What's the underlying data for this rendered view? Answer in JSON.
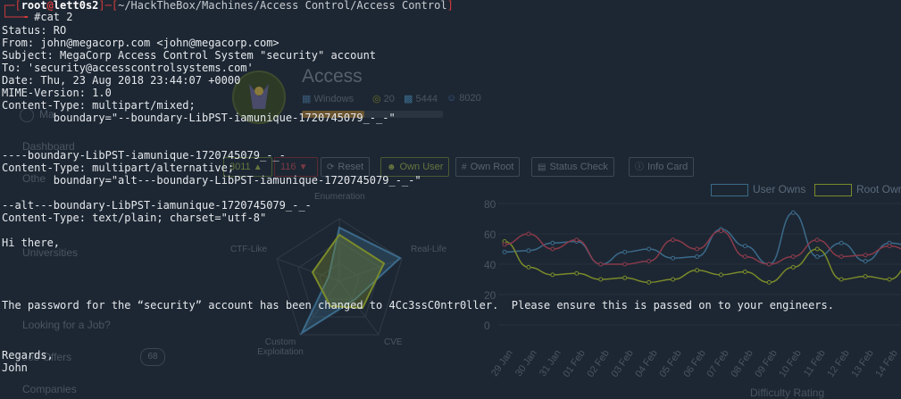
{
  "background": {
    "machine": {
      "name": "Access",
      "os": "Windows",
      "points": "20",
      "owns": "5444",
      "users": "8020",
      "nav_label": "Ma",
      "upvotes": "3011",
      "downvotes": "116"
    },
    "sidebar": [
      "Dashboard",
      "Othe",
      "Universities",
      "Looking for a Job?",
      "Job Offers",
      "Companies"
    ],
    "sidebar_badge": "68",
    "buttons": [
      {
        "icon": "refresh-icon",
        "label": "Reset"
      },
      {
        "icon": "user-icon",
        "label": "Own User"
      },
      {
        "icon": "hash-icon",
        "label": "Own Root"
      },
      {
        "icon": "check-icon",
        "label": "Status Check"
      },
      {
        "icon": "info-icon",
        "label": "Info Card"
      }
    ],
    "radar": {
      "labels": [
        "Enumeration",
        "Real-Life",
        "CVE",
        "Custom Exploitation",
        "CTF-Like"
      ]
    },
    "bottom_label": "Difficulty Rating",
    "chart_data": {
      "type": "line",
      "categories": [
        "29 Jan",
        "30 Jan",
        "31 Jan",
        "01 Feb",
        "02 Feb",
        "03 Feb",
        "04 Feb",
        "05 Feb",
        "06 Feb",
        "07 Feb",
        "08 Feb",
        "09 Feb",
        "10 Feb",
        "11 Feb",
        "12 Feb",
        "13 Feb",
        "14 Feb",
        "15"
      ],
      "series": [
        {
          "name": "User Owns",
          "color": "#3b6a8a",
          "values": [
            48,
            49,
            54,
            55,
            40,
            48,
            50,
            44,
            45,
            63,
            52,
            40,
            74,
            45,
            54,
            42,
            54,
            52
          ]
        },
        {
          "name": "Root Owns",
          "color": "#7a8a2a",
          "values": [
            55,
            38,
            33,
            34,
            30,
            31,
            28,
            30,
            36,
            33,
            35,
            28,
            38,
            50,
            30,
            32,
            30,
            42
          ]
        },
        {
          "name": "",
          "color": "#8a3a4a",
          "values": [
            53,
            60,
            50,
            56,
            40,
            40,
            42,
            56,
            50,
            62,
            45,
            40,
            45,
            56,
            45,
            46,
            52,
            48
          ]
        }
      ],
      "ylim": [
        0,
        80
      ],
      "yticks": [
        "80",
        "60",
        "40",
        "20",
        "0"
      ]
    }
  },
  "terminal": {
    "prompt_user": "root",
    "prompt_at": "@",
    "prompt_host": "lett0s2",
    "prompt_path": "~/HackTheBox/Machines/Access Control/Access Control",
    "command": "#cat 2",
    "lines": [
      "Status: RO",
      "From: john@megacorp.com <john@megacorp.com>",
      "Subject: MegaCorp Access Control System \"security\" account",
      "To: 'security@accesscontrolsystems.com'",
      "Date: Thu, 23 Aug 2018 23:44:07 +0000",
      "MIME-Version: 1.0",
      "Content-Type: multipart/mixed;",
      "        boundary=\"--boundary-LibPST-iamunique-1720745079_-_-\"",
      "",
      "",
      "----boundary-LibPST-iamunique-1720745079_-_-",
      "Content-Type: multipart/alternative;",
      "        boundary=\"alt---boundary-LibPST-iamunique-1720745079_-_-\"",
      "",
      "--alt---boundary-LibPST-iamunique-1720745079_-_-",
      "Content-Type: text/plain; charset=\"utf-8\"",
      "",
      "Hi there,",
      "",
      "",
      "",
      "",
      "The password for the “security” account has been changed to 4Cc3ssC0ntr0ller.  Please ensure this is passed on to your engineers.",
      "",
      "",
      "",
      "Regards,",
      "John"
    ]
  }
}
